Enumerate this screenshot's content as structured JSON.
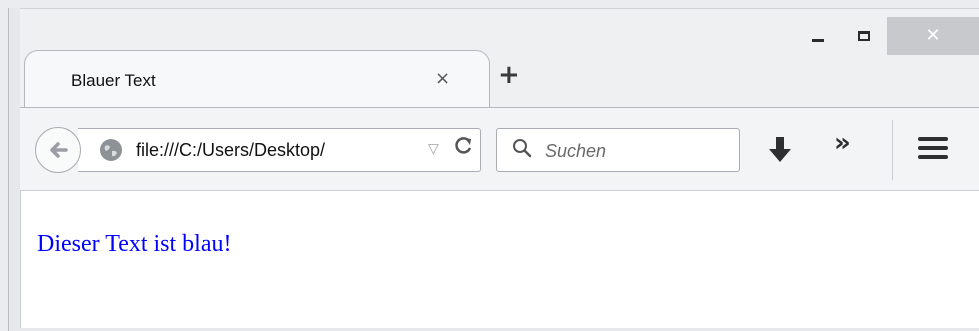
{
  "window": {
    "minimize_icon": "minimize-icon",
    "maximize_icon": "maximize-icon",
    "close_glyph": "✕"
  },
  "tab": {
    "title": "Blauer Text",
    "close_glyph": "×",
    "new_tab_glyph": "+"
  },
  "toolbar": {
    "url": "file:///C:/Users/Desktop/",
    "dropmarker_glyph": "▽",
    "reload_glyph": "C",
    "search_placeholder": "Suchen",
    "overflow_glyph": "»"
  },
  "page": {
    "text": "Dieser Text ist blau!",
    "text_color": "#0000ff"
  }
}
